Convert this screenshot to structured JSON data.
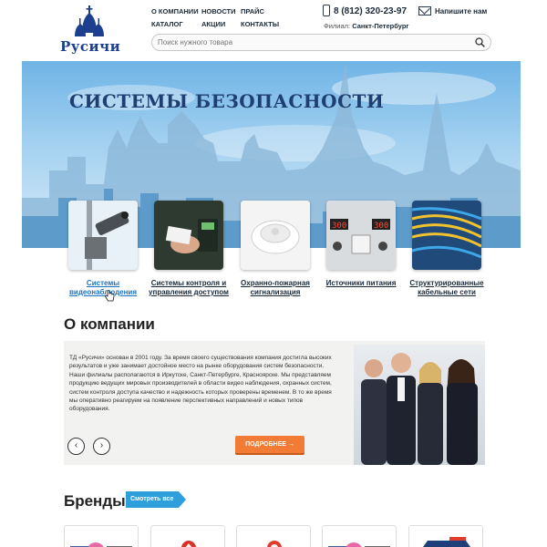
{
  "header": {
    "logo_text": "Русичи",
    "nav": [
      "О КОМПАНИИ",
      "НОВОСТИ",
      "ПРАЙС",
      "КАТАЛОГ",
      "АКЦИИ",
      "КОНТАКТЫ"
    ],
    "phone": "8 (812) 320-23-97",
    "branch_label": "Филиал:",
    "branch_city": "Санкт-Петербург",
    "mail_label": "Напишите нам",
    "search_placeholder": "Поиск нужного товара"
  },
  "hero": {
    "title": "СИСТЕМЫ БЕЗОПАСНОСТИ"
  },
  "categories": [
    {
      "label": "Системы видеонаблюдения",
      "active": true
    },
    {
      "label": "Системы контроля и управления доступом",
      "active": false
    },
    {
      "label": "Охранно-пожарная сигнализация",
      "active": false
    },
    {
      "label": "Источники питания",
      "active": false
    },
    {
      "label": "Структурированные кабельные сети",
      "active": false
    }
  ],
  "about": {
    "title": "О компании",
    "text": "ТД «Русичи» основан в 2001 году. За время своего существования компания достигла высоких результатов и уже занимает достойное место на рынке оборудования систем безопасности. Наши филиалы располагаются в Иркутске, Санкт-Петербурге, Красноярске. Мы представляем продукцию ведущих мировых производителей в области видео наблюдения, охранных систем, систем контроля доступа качество и надежность которых проверены временем. В то же время мы оперативно реагируем на появление перспективных направлений и новых типов оборудования.",
    "more_label": "ПОДРОБНЕЕ →",
    "prev_label": "‹",
    "next_label": "›"
  },
  "brands": {
    "title": "Бренды",
    "view_all": "Смотреть все"
  },
  "colors": {
    "accent_orange": "#f27b35",
    "accent_blue": "#2f9fdb",
    "link_blue": "#1d73c2"
  }
}
